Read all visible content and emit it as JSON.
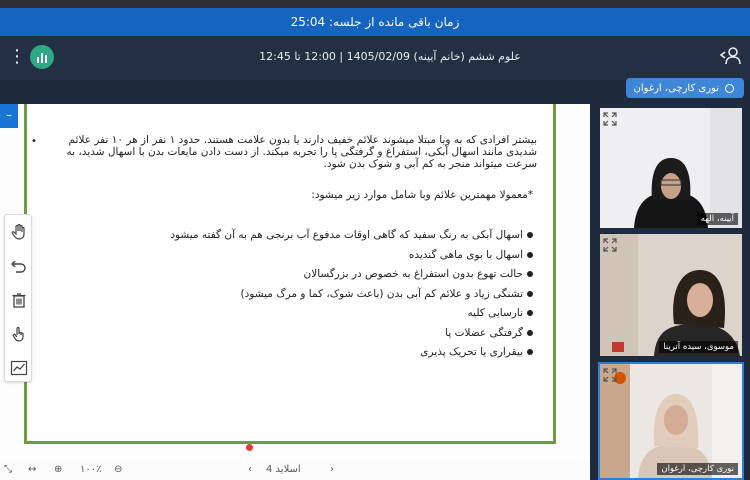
{
  "timer": {
    "label": "زمان باقی مانده از جلسه: 25:04"
  },
  "header": {
    "title": "علوم ششم (خانم آیینه) 1405/02/09 | 12:00 تا 12:45"
  },
  "presenter": {
    "name": "نوری کارچی، ارغوان"
  },
  "slide": {
    "paragraph": "بیشتر افرادی که به وبا مبتلا میشوند علائم خفیف دارند یا بدون علامت هستند. حدود ۱ نفر از هر ۱۰ نفر علائم شدیدی مانند اسهال آبکی، استفراغ و گرفتگی پا را تجربه میکند. از دست دادن مایعات بدن با اسهال شدید، به سرعت میتواند منجر به کم آبی و شوک بدن شود.",
    "intro": "*معمولا مهمترین علائم وبا شامل موارد زیر میشود:",
    "items": [
      "اسهال آبکی به رنگ سفید که گاهی اوقات مدفوع آب برنجی هم به آن گفته میشود",
      "اسهال با بوی ماهی گندیده",
      "حالت تهوع بدون استفراغ به خصوص در بزرگسالان",
      "تشنگی زیاد و علائم کم آبی بدن (باعث شوک، کما و مرگ میشود)",
      "نارسایی کلیه",
      "گرفتگی عضلات پا",
      "بیقراری یا تحریک پذیری"
    ]
  },
  "bottom": {
    "zoom": "۱۰۰٪",
    "slide_label": "اسلاید 4"
  },
  "participants": [
    {
      "name": "آیینه، الهه"
    },
    {
      "name": "موسوی، سیده آترینا"
    },
    {
      "name": "نوری کارچی، ارغوان"
    }
  ],
  "colors": {
    "accent": "#1565c0",
    "header": "#232f42",
    "slide_border": "#6a9d3f",
    "logo": "#2fa886"
  },
  "icons": [
    "menu-icon",
    "app-logo-icon",
    "users-icon",
    "hand-icon",
    "undo-icon",
    "trash-icon",
    "pointer-icon",
    "chart-icon",
    "expand-icon",
    "zoom-in-icon",
    "zoom-out-icon"
  ]
}
